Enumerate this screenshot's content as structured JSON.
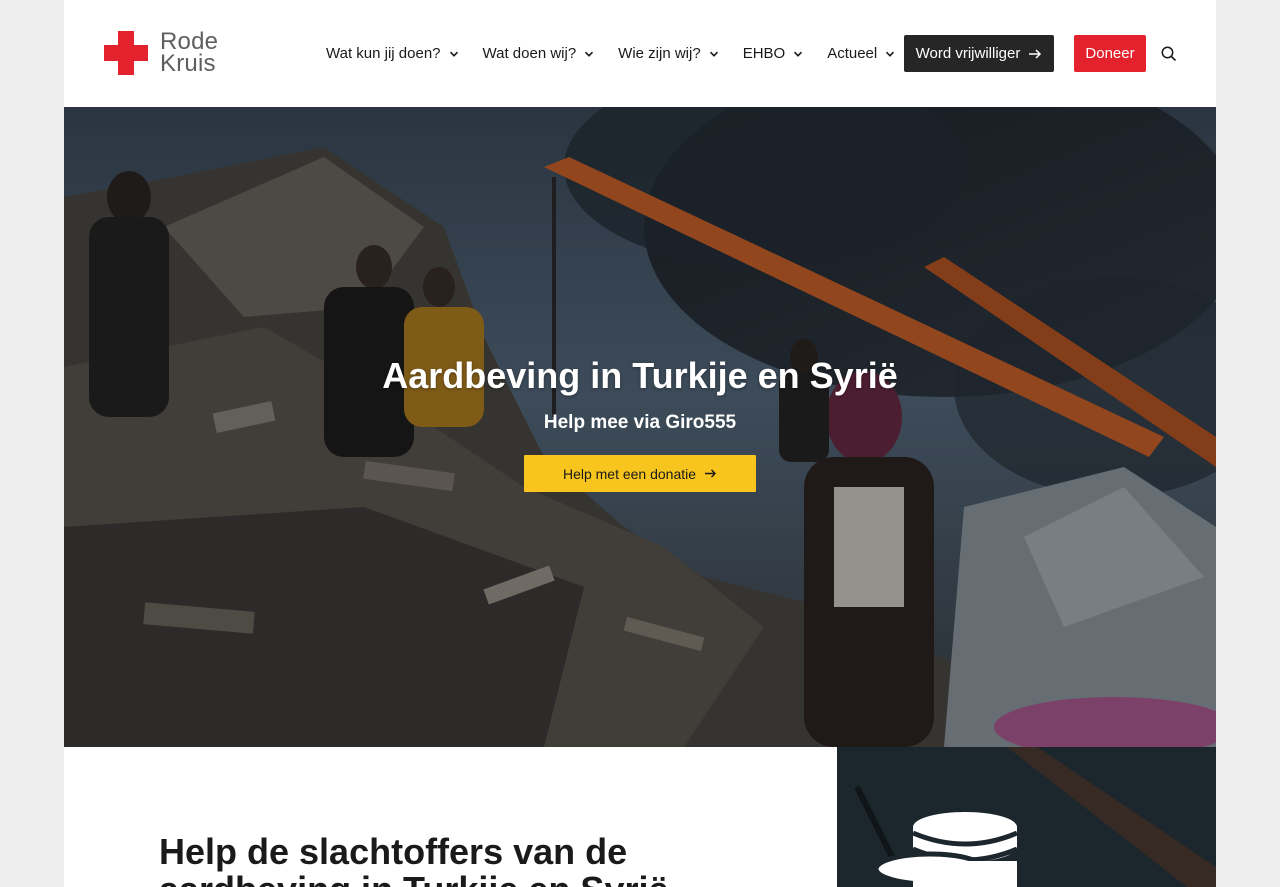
{
  "header": {
    "logo": {
      "line1": "Rode",
      "line2": "Kruis"
    },
    "nav": [
      {
        "label": "Wat kun jij doen?"
      },
      {
        "label": "Wat doen wij?"
      },
      {
        "label": "Wie zijn wij?"
      },
      {
        "label": "EHBO"
      },
      {
        "label": "Actueel"
      }
    ],
    "volunteer_label": "Word vrijwilliger",
    "donate_label": "Doneer",
    "icons": {
      "search": "search-icon",
      "chevron": "chevron-down-icon",
      "arrow": "arrow-right-icon"
    }
  },
  "hero": {
    "title": "Aardbeving in Turkije en Syrië",
    "subtitle": "Help mee via Giro555",
    "cta_label": "Help met een donatie"
  },
  "section": {
    "title": "Help de slachtoffers van de aardbeving in Turkije en Syrië",
    "icon": "coins-icon"
  },
  "colors": {
    "brand_red": "#e4222e",
    "cta_yellow": "#f7c51d",
    "dark_button": "#262626"
  }
}
